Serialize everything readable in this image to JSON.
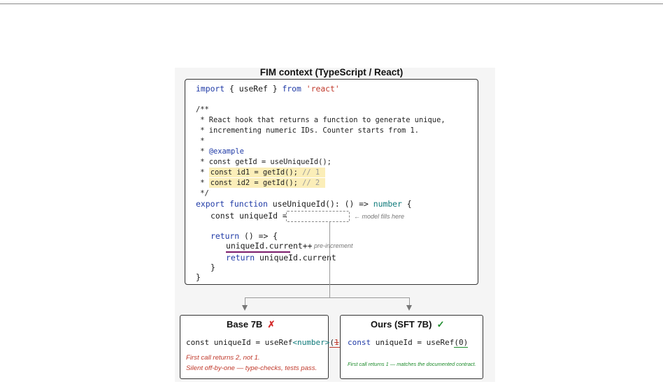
{
  "figure": {
    "title": "FIM context (TypeScript / React)"
  },
  "code": {
    "import_kw": "import",
    "import_mid": " { useRef } ",
    "from_kw": "from",
    "import_str": " 'react'",
    "doc_open": "/**",
    "doc1": " * React hook that returns a function to generate unique,",
    "doc2": " * incrementing numeric IDs. Counter starts from 1.",
    "doc3": " *",
    "doc4_star": " * ",
    "doc4_tag": "@example",
    "doc5": " * const getId = useUniqueId();",
    "doc6_star": " * ",
    "doc6_code": "const id1 = getId();",
    "doc6_cm": " // 1",
    "doc7_star": " * ",
    "doc7_code": "const id2 = getId();",
    "doc7_cm": " // 2",
    "doc_close": " */",
    "export_kw": "export function",
    "sig": " useUniqueId(): () => ",
    "ret_type": "number",
    "sig_end": " {",
    "const_line": "const uniqueId = ",
    "return_kw": "return",
    "return_rest": " () => {",
    "incr_line": "uniqueId.current++",
    "return2_kw": "return",
    "return2_rest": " uniqueId.current",
    "close_inner": "}",
    "close_outer": "}"
  },
  "annotations": {
    "model_fills": "← model fills here",
    "pre_increment": "pre-increment"
  },
  "panels": {
    "base": {
      "title": "Base 7B",
      "mark": "✗",
      "code_prefix": "const uniqueId = useRef",
      "generic": "<number>",
      "arg_open": "(",
      "arg_value": "1",
      "arg_close": ")",
      "note1": "First call returns 2, not 1.",
      "note2": "Silent off-by-one — type-checks, tests pass."
    },
    "ours": {
      "title": "Ours (SFT 7B)",
      "mark": "✓",
      "code_kw": "const",
      "code_mid": " uniqueId = useRef",
      "arg": "(0)",
      "note": "First call returns 1 — matches the documented contract."
    }
  },
  "colors": {
    "keyword": "#1f3aa6",
    "string": "#c0392b",
    "type": "#0f7a7a",
    "highlight": "#fbeeb8",
    "bad": "#d42a2a",
    "good": "#1e8c2c"
  }
}
